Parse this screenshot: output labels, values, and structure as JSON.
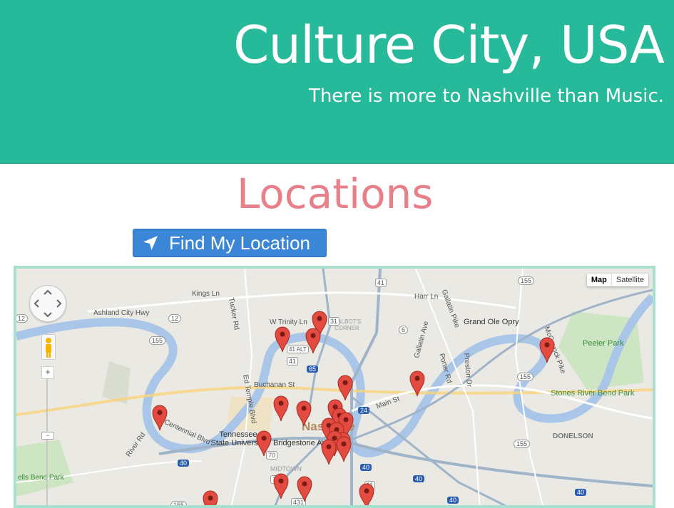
{
  "header": {
    "title": "Culture City, USA",
    "tagline": "There is more to Nashville than Music."
  },
  "section": {
    "title": "Locations"
  },
  "locate_button": {
    "label": "Find My Location",
    "icon": "location-arrow-icon"
  },
  "map": {
    "type_controls": [
      "Map",
      "Satellite"
    ],
    "active_type": "Map",
    "zoom_in_label": "+",
    "zoom_out_label": "−",
    "labels": {
      "city": "Nashville",
      "kings_ln": "Kings Ln",
      "ashland": "Ashland City Hwy",
      "tucker": "Tucker Rd",
      "trinity": "W Trinity Ln",
      "harr": "Harr Ln",
      "gallatin_pike": "Gallatin Pike",
      "grand_ole_opry": "Grand Ole Opry",
      "peeler": "Peeler Park",
      "stones": "Stones River Bend Park",
      "buchanan": "Buchanan St",
      "main_st": "Main St",
      "tsu": "Tennessee State University",
      "bridgestone": "Bridgestone Arena",
      "donelson": "DONELSON",
      "midtown": "MIDTOWN",
      "bells_bend": "ells Bend Park",
      "talbots": "TALBOT'S CORNER",
      "preston": "Preston Dr",
      "porter": "Porter Rd",
      "gallatin_ave": "Gallatin Ave",
      "mcgavock": "McGavock Pike",
      "centennial": "Centennial Blvd",
      "ed_temple": "Ed Temple Blvd",
      "river_rd": "River Rd",
      "hwy_41": "41",
      "hwy_155a": "155",
      "hwy_12": "12",
      "hwy_155b": "155",
      "hwy_6": "6",
      "hwy_65": "65",
      "hwy_24": "24",
      "hwy_40a": "40",
      "hwy_40b": "40",
      "hwy_40c": "40",
      "hwy_40d": "40",
      "hwy_40e": "40",
      "hwy_155c": "155",
      "hwy_155d": "155",
      "hwy_155e": "155",
      "hwy_11": "11",
      "hwy_70": "70",
      "hwy_431": "431",
      "hwy_12b": "12",
      "hwy_31": "31",
      "hwy_41b": "41",
      "hwy_41alt": "41 ALT",
      "hwy_70b": "70"
    }
  },
  "colors": {
    "header_bg": "#26b99a",
    "title_text": "#ffffff",
    "section_title": "#e8808a",
    "button_bg": "#3b86d6",
    "map_border": "#a8e0d0",
    "marker": "#e34b40"
  }
}
